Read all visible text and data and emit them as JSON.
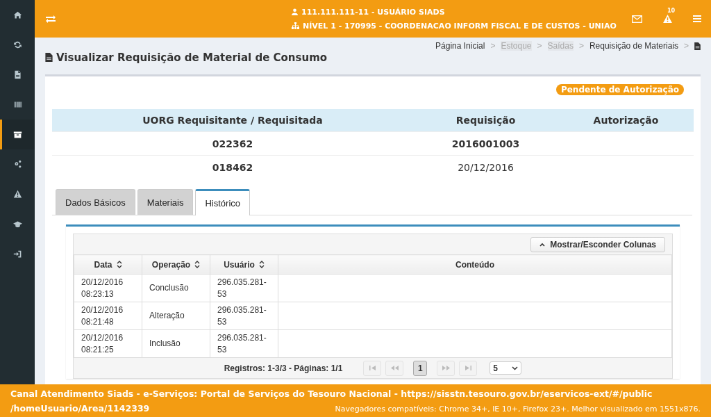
{
  "sidebar": {
    "items": [
      {
        "selected": false
      },
      {
        "selected": false
      },
      {
        "selected": false
      },
      {
        "selected": false
      },
      {
        "selected": true
      },
      {
        "selected": false
      },
      {
        "selected": false
      },
      {
        "selected": false
      },
      {
        "selected": false
      }
    ]
  },
  "topbar": {
    "user": "111.111.111-11 - USUÁRIO SIADS",
    "level": "NÍVEL 1 - 170995 - COORDENACAO INFORM FISCAL E DE CUSTOS - UNIAO",
    "alerts_badge": "10"
  },
  "page": {
    "title": "Visualizar Requisição de Material de Consumo"
  },
  "breadcrumb": [
    {
      "label": "Página Inicial",
      "disabled": false
    },
    {
      "label": "Estoque",
      "disabled": true
    },
    {
      "label": "Saídas",
      "disabled": true
    },
    {
      "label": "Requisição de Materiais",
      "disabled": false
    }
  ],
  "breadcrumb_separator": ">",
  "status_badge": "Pendente de Autorização",
  "summary": {
    "columns": [
      "UORG Requisitante / Requisitada",
      "Requisição",
      "Autorização"
    ],
    "rows": [
      {
        "cells": [
          "022362",
          "2016001003",
          ""
        ],
        "bold": [
          true,
          true,
          false
        ]
      },
      {
        "cells": [
          "018462",
          "20/12/2016",
          ""
        ],
        "bold": [
          true,
          false,
          false
        ]
      }
    ]
  },
  "tabs": [
    {
      "label": "Dados Básicos",
      "selected": false
    },
    {
      "label": "Materiais",
      "selected": false
    },
    {
      "label": "Histórico",
      "selected": true
    }
  ],
  "grid": {
    "toggle_button": "Mostrar/Esconder Colunas",
    "columns": [
      {
        "label": "Data",
        "sortable": true
      },
      {
        "label": "Operação",
        "sortable": true
      },
      {
        "label": "Usuário",
        "sortable": true
      },
      {
        "label": "Conteúdo",
        "sortable": false
      }
    ],
    "rows": [
      [
        "20/12/2016 08:23:13",
        "Conclusão",
        "296.035.281-53",
        ""
      ],
      [
        "20/12/2016 08:21:48",
        "Alteração",
        "296.035.281-53",
        ""
      ],
      [
        "20/12/2016 08:21:25",
        "Inclusão",
        "296.035.281-53",
        ""
      ]
    ],
    "pager": {
      "records": "Registros: 1-3/3 - Páginas: 1/1",
      "pages": [
        {
          "label": "1",
          "selected": true
        }
      ],
      "first_disabled": true,
      "prev_disabled": true,
      "next_disabled": true,
      "last_disabled": true,
      "page_size": "5"
    }
  },
  "footer": {
    "channel_lines": [
      "Canal Atendimento Siads - e-Serviços: Portal de Serviços do Tesouro Nacional - https://sisstn.tesouro.gov.br/eservicos-ext/#/public",
      "/homeUsuario/Area/1142339"
    ],
    "browsers": "Navegadores compatíveis: Chrome 34+, IE 10+, Firefox 23+. Melhor visualizado em 1551x876."
  }
}
